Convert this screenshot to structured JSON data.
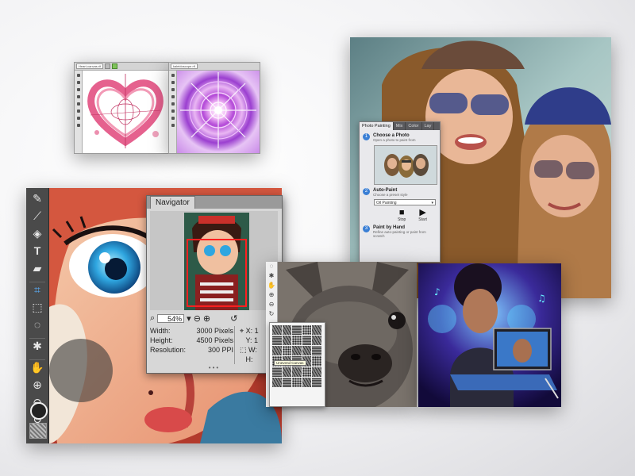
{
  "navigator": {
    "title": "Navigator",
    "zoom": "54%",
    "width_label": "Width:",
    "width_value": "3000 Pixels",
    "height_label": "Height:",
    "height_value": "4500 Pixels",
    "resolution_label": "Resolution:",
    "resolution_value": "300 PPI",
    "x_label": "X:",
    "x_value": "1",
    "y_label": "Y:",
    "y_value": "1",
    "w_label": "W:",
    "h_label": "H:"
  },
  "photo_painting": {
    "tabs": [
      "Photo Painting",
      "Mix",
      "Color",
      "Lay"
    ],
    "step1_title": "Choose a Photo",
    "step1_sub": "Open a photo to paint from",
    "step2_title": "Auto-Paint",
    "step2_sub": "Choose a preset style",
    "preset": "Oil Painting",
    "stop": "Stop",
    "start": "Start",
    "step3_title": "Paint by Hand",
    "step3_sub": "Refine auto-painting or paint from scratch"
  },
  "paper_picker": {
    "label": "Unevend Canvas"
  },
  "small_windows": {
    "a_tab": "Heart-canvas.rif",
    "b_tab": "kaleidoscope.rif"
  },
  "icons": {
    "main_tools": [
      "brush-icon",
      "dropper-icon",
      "fill-icon",
      "text-icon",
      "eraser-icon",
      "crop-icon",
      "select-rect-icon",
      "lasso-icon",
      "shape-icon",
      "hand-icon",
      "zoom-in-icon",
      "zoom-out-icon",
      "rotate-icon"
    ]
  },
  "colors": {
    "heart": "#e0457a",
    "accent_blue": "#3a7fd5",
    "kaleido": "#b44bd8"
  }
}
